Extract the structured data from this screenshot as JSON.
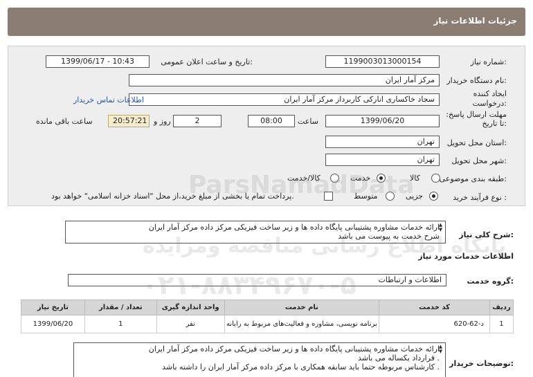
{
  "header": {
    "title": "جزئیات اطلاعات نیاز"
  },
  "form": {
    "need_number": {
      "label": "شماره نیاز:",
      "value": "1199003013000154"
    },
    "announce_datetime": {
      "label": "تاریخ و ساعت اعلان عمومی:",
      "value": "1399/06/17 - 10:43"
    },
    "buyer_org": {
      "label": "نام دستگاه خریدار:",
      "value": "مرکز آمار ایران"
    },
    "requester": {
      "label": "ایجاد کننده درخواست:",
      "value": "سجاد خاکساری انارکی کاربرداز مرکز آمار ایران",
      "contact_link": "اطلاعات تماس خریدار"
    },
    "deadline": {
      "label": "مهلت ارسال پاسخ: تا تاریخ:",
      "date": "1399/06/20",
      "time_label": "ساعت",
      "time": "08:00",
      "days": "2",
      "days_label": "روز و",
      "remaining": "20:57:21",
      "remaining_label": "ساعت باقی مانده"
    },
    "province": {
      "label": "استان محل تحویل:",
      "value": "تهران"
    },
    "city": {
      "label": "شهر محل تحویل:",
      "value": "تهران"
    },
    "category": {
      "label": "طبقه بندی موضوعی:",
      "options": [
        "کالا",
        "خدمت",
        "کالا/خدمت"
      ],
      "selected": "خدمت"
    },
    "purchase_type": {
      "label": "نوع فرآیند خرید :",
      "options": [
        "جزیی",
        "متوسط"
      ],
      "selected": "جزیی",
      "note": "پرداخت تمام یا بخشی از مبلغ خرید،از محل \"اسناد خزانه اسلامی\" خواهد بود."
    }
  },
  "summary": {
    "label": "شرح کلی نیاز:",
    "lines": [
      "ارائه خدمات مشاوره پشتیبانی پایگاه داده ها و زیر ساخت فیزیکی مرکز داده مرکز آمار ایران",
      "شرح خدمت به پیوست می باشد"
    ]
  },
  "services_section": {
    "title": "اطلاعات خدمات مورد نیاز",
    "group_label": "گروه خدمت:",
    "group_value": "اطلاعات و ارتباطات",
    "columns": [
      "ردیف",
      "کد خدمت",
      "نام خدمت",
      "واحد اندازه گیری",
      "تعداد / مقدار",
      "تاریخ نیاز"
    ],
    "rows": [
      [
        "1",
        "د-62-620",
        "برنامه نویسی، مشاوره و فعالیت‌های مربوط به رایانه",
        "نفر",
        "1",
        "1399/06/20"
      ]
    ]
  },
  "buyer_notes": {
    "label": "توضیحات خریدار:",
    "lines": [
      "ارائه خدمات مشاوره پشتیبانی پایگاه داده ها و زیر ساخت فیزیکی مرکز داده مرکز آمار ایران",
      "قرارداد یکساله می باشد .",
      "کارشناس مربوطه حتما باید سابقه همکاری با مرکز داده مرکز آمار ایران را داشته باشد ."
    ]
  },
  "watermark": {
    "brand": "ParsNamadData",
    "tagline": "پایگاه اطلاع رسانی مناقصه ومزایده",
    "phone": "۰۲۱-۸۸۳۴۹۶۷۰-۵"
  }
}
